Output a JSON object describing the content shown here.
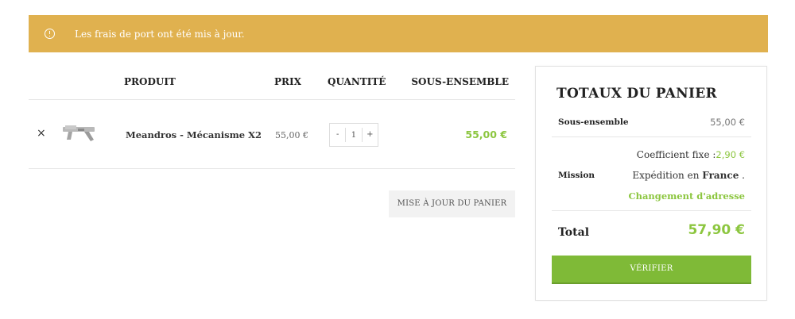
{
  "notice": {
    "text": "Les frais de port ont été mis à jour."
  },
  "cart": {
    "headers": {
      "product": "PRODUIT",
      "price": "PRIX",
      "quantity": "QUANTITÉ",
      "subtotal": "SOUS-ENSEMBLE"
    },
    "rows": [
      {
        "remove": "×",
        "name": "Meandros - Mécanisme X2",
        "price": "55,00 €",
        "qty": "1",
        "minus": "-",
        "plus": "+",
        "subtotal": "55,00 €"
      }
    ],
    "update_label": "MISE À JOUR DU PANIER"
  },
  "totals": {
    "title": "TOTAUX DU PANIER",
    "subtotal_label": "Sous-ensemble",
    "subtotal_value": "55,00 €",
    "shipping_label": "Mission",
    "shipping_method": "Coefficient fixe :",
    "shipping_cost": "2,90 €",
    "shipping_to_prefix": "Expédition en",
    "shipping_country": "France",
    "shipping_to_suffix": ".",
    "change_address": "Changement d'adresse",
    "total_label": "Total",
    "total_value": "57,90 €",
    "checkout_label": "VÉRIFIER"
  },
  "colors": {
    "notice_bg": "#e0b14f",
    "accent_green": "#8cc63f",
    "button_green": "#7fba37"
  }
}
